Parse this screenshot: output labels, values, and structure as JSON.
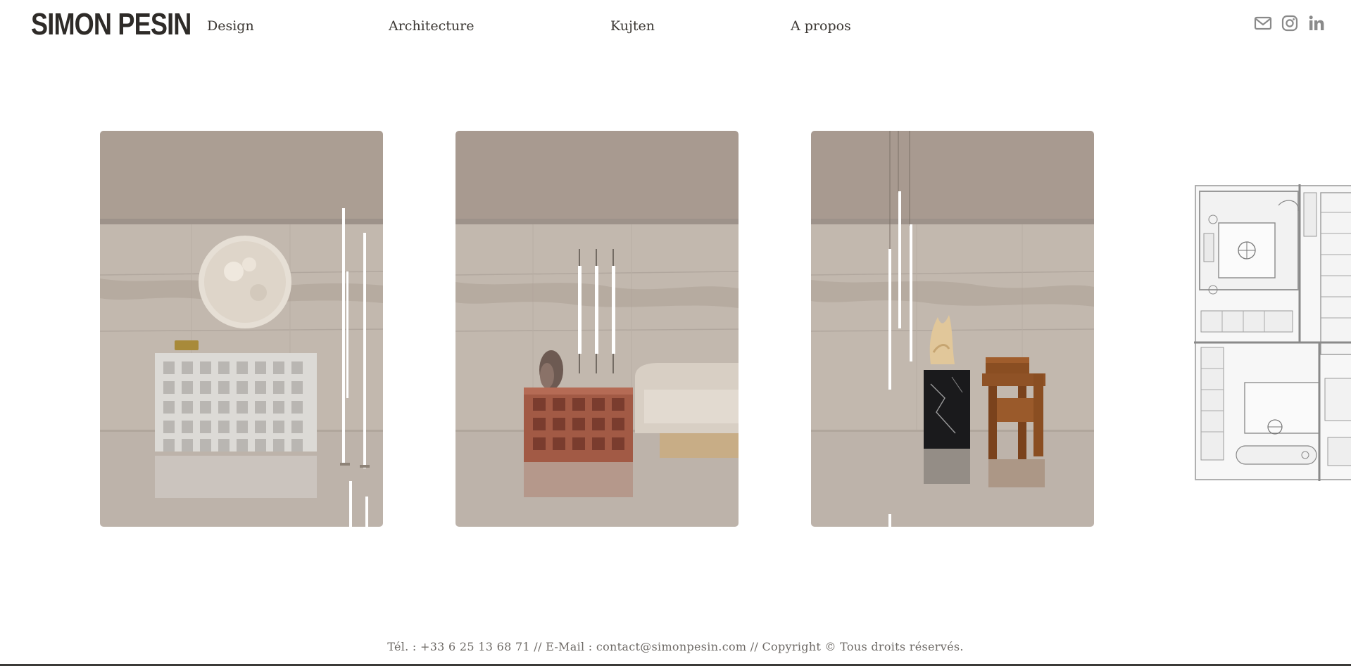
{
  "header": {
    "logo": "SIMON PESIN",
    "nav": [
      "Design",
      "Architecture",
      "Kujten",
      "A propos"
    ],
    "social_icons": [
      "mail-icon",
      "instagram-icon",
      "linkedin-icon"
    ]
  },
  "gallery": {
    "cards": [
      {
        "name": "gallery-image-marble-console"
      },
      {
        "name": "gallery-image-terracotta-table"
      },
      {
        "name": "gallery-image-wooden-chair"
      }
    ],
    "partial_card": {
      "name": "gallery-image-floor-plan"
    }
  },
  "footer": {
    "text": "Tél. : +33 6 25 13 68 71 // E-Mail : contact@simonpesin.com // Copyright © Tous droits réservés."
  },
  "colors": {
    "text": "#3b3733",
    "icon": "#8a8a8a",
    "wall": "#bfb4aa",
    "ceiling": "#a89a90"
  }
}
